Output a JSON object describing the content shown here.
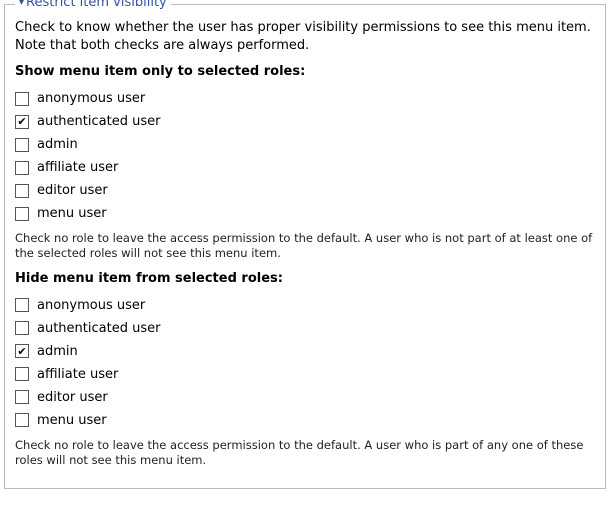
{
  "fieldset": {
    "legend": "Restrict item visibility",
    "intro": "Check to know whether the user has proper visibility permissions to see this menu item. Note that both checks are always performed.",
    "show": {
      "heading": "Show menu item only to selected roles:",
      "roles": [
        {
          "label": "anonymous user",
          "checked": false
        },
        {
          "label": "authenticated user",
          "checked": true
        },
        {
          "label": "admin",
          "checked": false
        },
        {
          "label": "affiliate user",
          "checked": false
        },
        {
          "label": "editor user",
          "checked": false
        },
        {
          "label": "menu user",
          "checked": false
        }
      ],
      "help": "Check no role to leave the access permission to the default. A user who is not part of at least one of the selected roles will not see this menu item."
    },
    "hide": {
      "heading": "Hide menu item from selected roles:",
      "roles": [
        {
          "label": "anonymous user",
          "checked": false
        },
        {
          "label": "authenticated user",
          "checked": false
        },
        {
          "label": "admin",
          "checked": true
        },
        {
          "label": "affiliate user",
          "checked": false
        },
        {
          "label": "editor user",
          "checked": false
        },
        {
          "label": "menu user",
          "checked": false
        }
      ],
      "help": "Check no role to leave the access permission to the default. A user who is part of any one of these roles will not see this menu item."
    }
  }
}
